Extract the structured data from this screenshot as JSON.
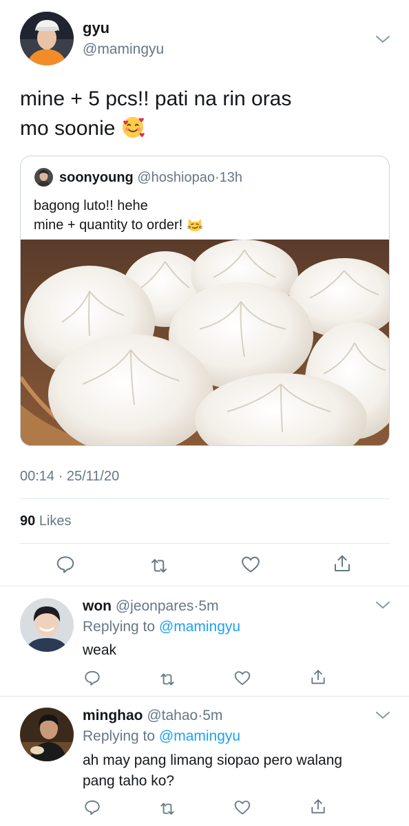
{
  "main_tweet": {
    "name": "gyu",
    "handle": "@mamingyu",
    "text_line1": "mine + 5 pcs!! pati na rin oras",
    "text_line2": "mo soonie",
    "emoji": "smiling-face-with-hearts",
    "timestamp": "00:14 · 25/11/20",
    "likes_count": "90",
    "likes_label": "Likes"
  },
  "quote": {
    "name": "soonyoung",
    "handle": "@hoshiopao",
    "separator": "·",
    "time": "13h",
    "text_line1": "bagong luto!! hehe",
    "text_line2": "mine + quantity to order!",
    "emoji": "smirking-cat-face"
  },
  "replies": [
    {
      "name": "won",
      "handle": "@jeonpares",
      "separator": "·",
      "time": "5m",
      "replying_label": "Replying to",
      "replying_to": "@mamingyu",
      "text": "weak"
    },
    {
      "name": "minghao",
      "handle": "@tahao",
      "separator": "·",
      "time": "5m",
      "replying_label": "Replying to",
      "replying_to": "@mamingyu",
      "text_line1": "ah may pang limang siopao pero walang",
      "text_line2": "pang taho ko?"
    }
  ],
  "colors": {
    "text": "#14171a",
    "muted": "#657786",
    "link": "#1da1f2",
    "divider": "#e1e8ed"
  },
  "icons": [
    "reply-icon",
    "retweet-icon",
    "like-icon",
    "share-icon",
    "chevron-down-icon"
  ]
}
